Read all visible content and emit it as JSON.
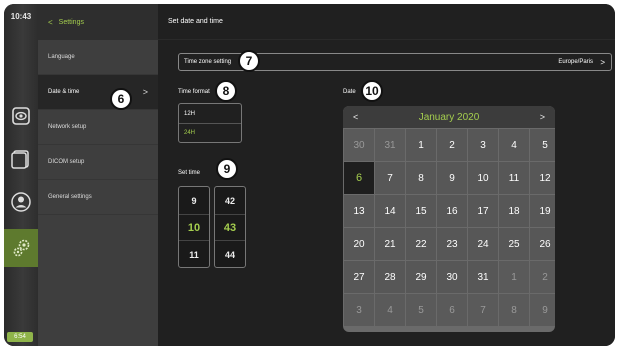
{
  "status": {
    "clock": "10:43",
    "battery": "6:54"
  },
  "menu": {
    "back_label": "Settings",
    "items": [
      {
        "label": "Language"
      },
      {
        "label": "Date & time"
      },
      {
        "label": "Network setup"
      },
      {
        "label": "DICOM setup"
      },
      {
        "label": "General settings"
      }
    ]
  },
  "main": {
    "title": "Set date and time",
    "timezone": {
      "label": "Time zone setting",
      "value": "Europe/Paris"
    },
    "time_format": {
      "label": "Time format",
      "options": [
        "12H",
        "24H"
      ],
      "selected": "24H"
    },
    "set_time": {
      "label": "Set time",
      "hours": [
        "9",
        "10",
        "11"
      ],
      "minutes": [
        "42",
        "43",
        "44"
      ]
    },
    "date": {
      "label": "Date",
      "month_title": "January 2020",
      "days": [
        [
          "30",
          "31",
          "1",
          "2",
          "3",
          "4",
          "5"
        ],
        [
          "6",
          "7",
          "8",
          "9",
          "10",
          "11",
          "12"
        ],
        [
          "13",
          "14",
          "15",
          "16",
          "17",
          "18",
          "19"
        ],
        [
          "20",
          "21",
          "22",
          "23",
          "24",
          "25",
          "26"
        ],
        [
          "27",
          "28",
          "29",
          "30",
          "31",
          "1",
          "2"
        ],
        [
          "3",
          "4",
          "5",
          "6",
          "7",
          "8",
          "9"
        ]
      ]
    }
  },
  "badges": [
    "6",
    "7",
    "8",
    "9",
    "10"
  ],
  "colors": {
    "accent": "#a4cd4e",
    "rail_active": "#5e7a2e"
  }
}
